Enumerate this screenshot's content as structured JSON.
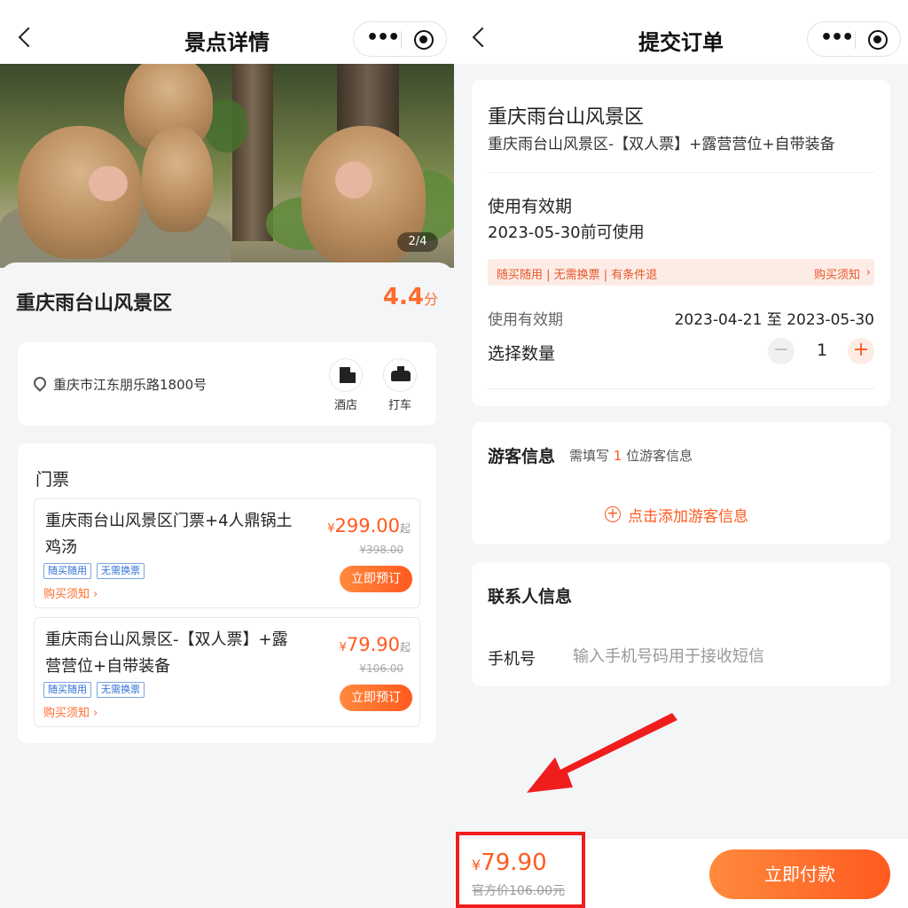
{
  "left": {
    "nav": {
      "title": "景点详情"
    },
    "hero": {
      "counter": "2/4"
    },
    "scenic": {
      "name": "重庆雨台山风景区",
      "score": "4.4",
      "score_unit": "分"
    },
    "address": {
      "text": "重庆市江东朋乐路1800号",
      "hotel_label": "酒店",
      "taxi_label": "打车"
    },
    "tickets": {
      "title": "门票",
      "items": [
        {
          "name": "重庆雨台山风景区门票+4人鼎锅土鸡汤",
          "currency": "¥",
          "price": "299.00",
          "suffix": "起",
          "original": "¥398.00",
          "tags": [
            "随买随用",
            "无需换票"
          ],
          "notice": "购买须知 ›",
          "button": "立即预订"
        },
        {
          "name": "重庆雨台山风景区-【双人票】+露营营位+自带装备",
          "currency": "¥",
          "price": "79.90",
          "suffix": "起",
          "original": "¥106.00",
          "tags": [
            "随买随用",
            "无需换票"
          ],
          "notice": "购买须知 ›",
          "button": "立即预订"
        }
      ]
    }
  },
  "right": {
    "nav": {
      "title": "提交订单"
    },
    "order": {
      "title": "重庆雨台山风景区",
      "subtitle": "重庆雨台山风景区-【双人票】+露营营位+自带装备",
      "valid_label": "使用有效期",
      "valid_value": "2023-05-30前可使用",
      "strip_left": "随买随用 | 无需换票 | 有条件退",
      "strip_right": "购买须知",
      "period_label": "使用有效期",
      "period_value": "2023-04-21 至 2023-05-30",
      "qty_label": "选择数量",
      "qty_value": "1",
      "minus": "−",
      "plus": "+"
    },
    "visitor": {
      "title": "游客信息",
      "hint_prefix": "需填写 ",
      "hint_count": "1",
      "hint_suffix": " 位游客信息",
      "add_label": "点击添加游客信息"
    },
    "contact": {
      "title": "联系人信息",
      "phone_label": "手机号",
      "phone_placeholder": "输入手机号码用于接收短信"
    },
    "footer": {
      "currency": "¥",
      "price": "79.90",
      "official_price": "官方价106.00元",
      "pay_button": "立即付款"
    },
    "colors": {
      "accent": "#ff5a1f",
      "highlight_box": "#f01d1d"
    }
  }
}
